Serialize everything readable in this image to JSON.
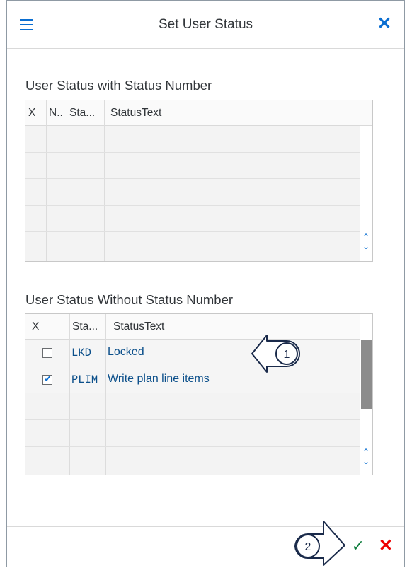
{
  "dialog": {
    "title": "Set User Status",
    "menu_icon": "hamburger-menu-icon",
    "close_icon": "close-icon",
    "close_glyph": "✕"
  },
  "with_number": {
    "title": "User Status with Status Number",
    "columns": [
      "X",
      "N..",
      "Sta...",
      "StatusText"
    ],
    "rows": []
  },
  "without_number": {
    "title": "User Status Without Status Number",
    "columns": [
      "X",
      "Sta...",
      "StatusText"
    ],
    "rows": [
      {
        "checked": false,
        "status": "LKD",
        "text": "Locked"
      },
      {
        "checked": true,
        "status": "PLIM",
        "text": "Write plan line items"
      }
    ]
  },
  "callouts": [
    "1",
    "2"
  ],
  "footer": {
    "ok_glyph": "✓",
    "cancel_glyph": "✕",
    "ok_icon": "checkmark-icon",
    "cancel_icon": "cancel-icon"
  },
  "scroll": {
    "up": "⌃",
    "down": "⌄"
  },
  "colors": {
    "accent": "#0a6ed1",
    "ok": "#107e3e",
    "cancel": "#ee0000"
  }
}
